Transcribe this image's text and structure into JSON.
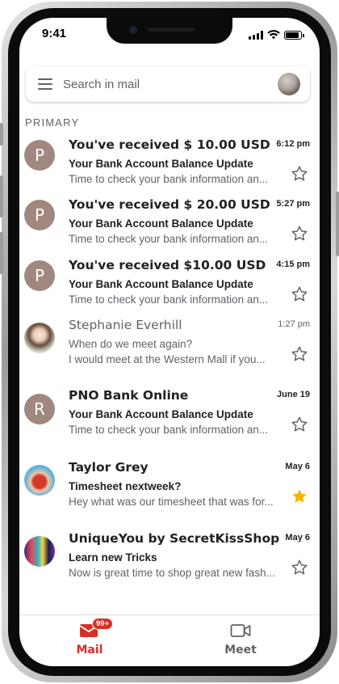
{
  "status_bar": {
    "time": "9:41",
    "battery_level": 0.9
  },
  "search": {
    "placeholder": "Search in mail"
  },
  "section": {
    "label": "PRIMARY"
  },
  "emails": [
    {
      "sender": "You've received $ 10.00 USD",
      "time": "6:12 pm",
      "subject": "Your Bank Account Balance Update",
      "snippet": "Time to check your bank information an...",
      "avatar_letter": "P",
      "unread": true,
      "starred": false
    },
    {
      "sender": "You've received $ 20.00 USD",
      "time": "5:27 pm",
      "subject": "Your Bank Account Balance Update",
      "snippet": "Time to check your bank information an...",
      "avatar_letter": "P",
      "unread": true,
      "starred": false
    },
    {
      "sender": "You've received $10.00 USD",
      "time": "4:15 pm",
      "subject": "Your Bank Account Balance Update",
      "snippet": "Time to check your bank information an...",
      "avatar_letter": "P",
      "unread": true,
      "starred": false
    },
    {
      "sender": "Stephanie Everhill",
      "time": "1:27 pm",
      "subject": "When do we meet again?",
      "snippet": "I would meet at the Western Mall if you...",
      "avatar_letter": "",
      "unread": false,
      "starred": false
    },
    {
      "sender": "PNO Bank Online",
      "time": "June 19",
      "subject": "Your Bank Account Balance Update",
      "snippet": "Time to check your bank information an...",
      "avatar_letter": "R",
      "unread": true,
      "starred": false
    },
    {
      "sender": "Taylor Grey",
      "time": "May 6",
      "subject": "Timesheet nextweek?",
      "snippet": "Hey what was our timesheet that was for...",
      "avatar_letter": "",
      "unread": true,
      "starred": true
    },
    {
      "sender": "UniqueYou by SecretKissShop",
      "time": "May 6",
      "subject": "Learn new Tricks",
      "snippet": "Now is great time to shop great new fash...",
      "avatar_letter": "",
      "unread": true,
      "starred": false
    }
  ],
  "bottom_nav": {
    "mail_label": "Mail",
    "mail_badge": "99+",
    "meet_label": "Meet"
  },
  "colors": {
    "accent_red": "#d93025",
    "avatar_brown": "#a1887f",
    "star_yellow": "#f4b400",
    "star_outline": "#5f6368"
  }
}
